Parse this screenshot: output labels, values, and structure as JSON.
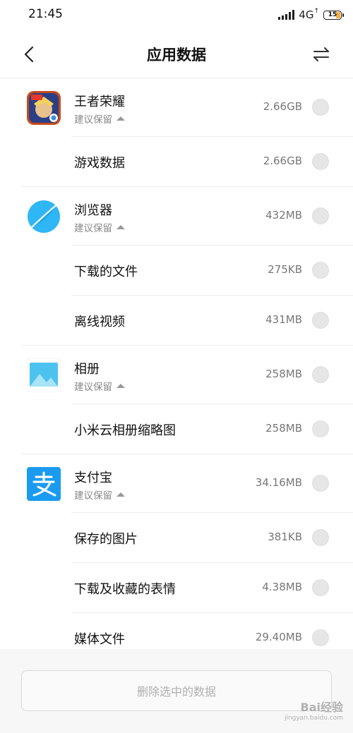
{
  "status_bar": {
    "time": "21:45",
    "network": "4G",
    "battery": "15"
  },
  "header": {
    "title": "应用数据",
    "back_icon": "back-chevron-icon",
    "swap_icon": "swap-arrows-icon"
  },
  "groups": [
    {
      "app": {
        "name": "王者荣耀",
        "hint": "建议保留",
        "size": "2.66GB",
        "icon": "honor-of-kings-icon"
      },
      "items": [
        {
          "label": "游戏数据",
          "size": "2.66GB"
        }
      ]
    },
    {
      "app": {
        "name": "浏览器",
        "hint": "建议保留",
        "size": "432MB",
        "icon": "browser-icon"
      },
      "items": [
        {
          "label": "下载的文件",
          "size": "275KB"
        },
        {
          "label": "离线视频",
          "size": "431MB"
        }
      ]
    },
    {
      "app": {
        "name": "相册",
        "hint": "建议保留",
        "size": "258MB",
        "icon": "gallery-icon"
      },
      "items": [
        {
          "label": "小米云相册缩略图",
          "size": "258MB"
        }
      ]
    },
    {
      "app": {
        "name": "支付宝",
        "hint": "建议保留",
        "size": "34.16MB",
        "icon": "alipay-icon"
      },
      "items": [
        {
          "label": "保存的图片",
          "size": "381KB"
        },
        {
          "label": "下载及收藏的表情",
          "size": "4.38MB"
        },
        {
          "label": "媒体文件",
          "size": "29.40MB"
        }
      ]
    }
  ],
  "footer": {
    "delete_label": "删除选中的数据"
  },
  "watermark": {
    "text": "Bai经验",
    "sub": "jingyan.baidu.com"
  },
  "colors": {
    "alipay": "#1a9bf0",
    "browser": "#2fb7f5",
    "check": "#e6e6e6",
    "hint": "#888888"
  }
}
